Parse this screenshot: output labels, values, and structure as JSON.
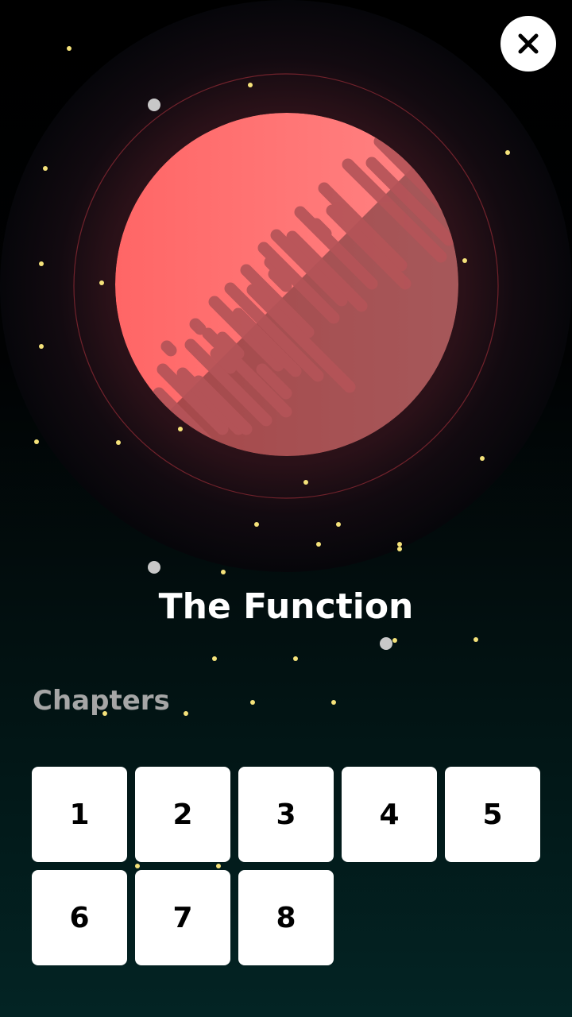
{
  "header": {
    "close_icon": "close-icon"
  },
  "hero": {
    "illustration": "planet-illustration",
    "planet_color": "#ff6b6b",
    "glow_color": "#3a1820",
    "star_color": "#f5e27a"
  },
  "title": "The Function",
  "chapters": {
    "label": "Chapters",
    "items": [
      "1",
      "2",
      "3",
      "4",
      "5",
      "6",
      "7",
      "8"
    ]
  },
  "colors": {
    "background_top": "#000000",
    "background_bottom": "#032424",
    "card": "#ffffff",
    "label_gray": "#a6a6a6"
  }
}
